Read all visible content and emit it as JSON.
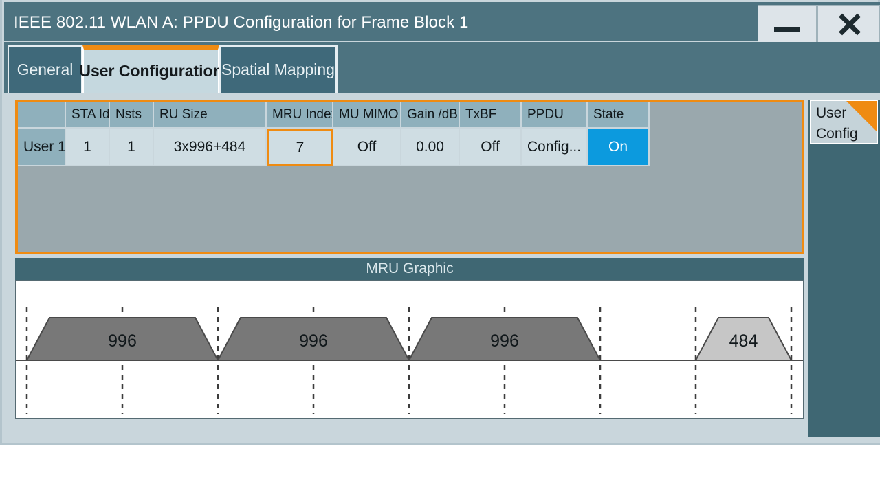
{
  "window": {
    "title": "IEEE 802.11 WLAN  A: PPDU Configuration for Frame Block 1",
    "minimize_label": "—",
    "close_label": "✕"
  },
  "tabs": [
    {
      "label": "General",
      "active": false
    },
    {
      "label": "User Configuration",
      "active": true
    },
    {
      "label": "Spatial Mapping",
      "active": false
    }
  ],
  "table": {
    "headers": [
      "",
      "STA Id",
      "Nsts",
      "RU Size",
      "MRU Index",
      "MU MIMO",
      "Gain /dB",
      "TxBF",
      "PPDU",
      "State"
    ],
    "rows": [
      {
        "user": "User 1",
        "sta_id": "1",
        "nsts": "1",
        "ru_size": "3x996+484",
        "mru_index": "7",
        "mu_mimo": "Off",
        "gain_db": "0.00",
        "txbf": "Off",
        "ppdu": "Config...",
        "state": "On"
      }
    ]
  },
  "mru_graphic": {
    "title": "MRU Graphic",
    "chart_data": {
      "type": "bar",
      "title": "MRU Graphic",
      "xlabel": "",
      "ylabel": "",
      "grid": true,
      "legend": "none",
      "gridline_count": 9,
      "blocks": [
        {
          "label": "996",
          "start_tick": 0,
          "end_tick": 2,
          "color": "#787878"
        },
        {
          "label": "996",
          "start_tick": 2,
          "end_tick": 4,
          "color": "#787878"
        },
        {
          "label": "996",
          "start_tick": 4,
          "end_tick": 6,
          "color": "#787878"
        },
        {
          "label": "484",
          "start_tick": 7,
          "end_tick": 8,
          "color": "#c6c6c6"
        }
      ]
    }
  },
  "sidebar": {
    "user_config_label": "User\nConfig",
    "user_config_line1": "User",
    "user_config_line2": "Config"
  },
  "colors": {
    "accent_orange": "#ef8b12",
    "title_bar": "#4d7380",
    "selected_blue": "#0c9ade",
    "table_body": "#9aa8ad",
    "ru_dark": "#787878",
    "ru_light": "#c6c6c6"
  }
}
